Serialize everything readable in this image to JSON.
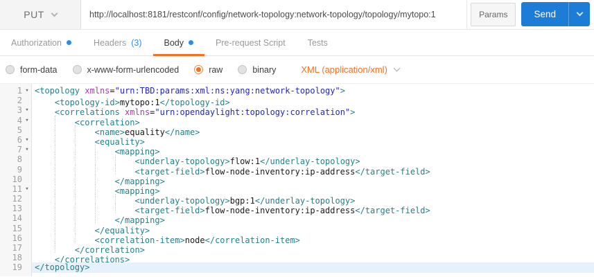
{
  "request_bar": {
    "method": "PUT",
    "url": "http://localhost:8181/restconf/config/network-topology:network-topology/topology/mytopo:1",
    "params_label": "Params",
    "send_label": "Send"
  },
  "tabs": [
    {
      "id": "authorization",
      "label": "Authorization",
      "dot": true,
      "count": "",
      "active": false
    },
    {
      "id": "headers",
      "label": "Headers",
      "dot": false,
      "count": "(3)",
      "active": false
    },
    {
      "id": "body",
      "label": "Body",
      "dot": true,
      "count": "",
      "active": true
    },
    {
      "id": "pre-request-script",
      "label": "Pre-request Script",
      "dot": false,
      "count": "",
      "active": false
    },
    {
      "id": "tests",
      "label": "Tests",
      "dot": false,
      "count": "",
      "active": false
    }
  ],
  "body_options": {
    "radios": [
      {
        "id": "form-data",
        "label": "form-data",
        "selected": false
      },
      {
        "id": "x-www-form-urlencoded",
        "label": "x-www-form-urlencoded",
        "selected": false
      },
      {
        "id": "raw",
        "label": "raw",
        "selected": true
      },
      {
        "id": "binary",
        "label": "binary",
        "selected": false
      }
    ],
    "content_type": "XML (application/xml)"
  },
  "colors": {
    "accent_orange": "#f47023",
    "dot_blue": "#2d8ceb",
    "send_blue": "#1c7cd6",
    "syntax_tag": "#23808a",
    "syntax_attr": "#a43db0",
    "syntax_string": "#2127c0",
    "syntax_text": "#1a1a1a",
    "line_number": "#9e9e9e",
    "active_line_bg": "#e6f1fb"
  },
  "editor": {
    "fold_marker": "▾",
    "lines": [
      {
        "num": 1,
        "fold": true,
        "active": false,
        "indent": 0,
        "segs": [
          {
            "t": "tag",
            "v": "<topology"
          },
          {
            "t": "text",
            "v": " "
          },
          {
            "t": "attr",
            "v": "xmlns"
          },
          {
            "t": "text",
            "v": "="
          },
          {
            "t": "str",
            "v": "\"urn:TBD:params:xml:ns:yang:network-topology\""
          },
          {
            "t": "tag",
            "v": ">"
          }
        ]
      },
      {
        "num": 2,
        "fold": false,
        "active": false,
        "indent": 1,
        "segs": [
          {
            "t": "tag",
            "v": "<topology-id>"
          },
          {
            "t": "text",
            "v": "mytopo:1"
          },
          {
            "t": "tag",
            "v": "</topology-id>"
          }
        ]
      },
      {
        "num": 3,
        "fold": true,
        "active": false,
        "indent": 1,
        "segs": [
          {
            "t": "tag",
            "v": "<correlations"
          },
          {
            "t": "text",
            "v": " "
          },
          {
            "t": "attr",
            "v": "xmlns"
          },
          {
            "t": "text",
            "v": "="
          },
          {
            "t": "str",
            "v": "\"urn:opendaylight:topology:correlation\""
          },
          {
            "t": "tag",
            "v": ">"
          }
        ]
      },
      {
        "num": 4,
        "fold": true,
        "active": false,
        "indent": 2,
        "segs": [
          {
            "t": "tag",
            "v": "<correlation>"
          }
        ]
      },
      {
        "num": 5,
        "fold": false,
        "active": false,
        "indent": 3,
        "segs": [
          {
            "t": "tag",
            "v": "<name>"
          },
          {
            "t": "text",
            "v": "equality"
          },
          {
            "t": "tag",
            "v": "</name>"
          }
        ]
      },
      {
        "num": 6,
        "fold": true,
        "active": false,
        "indent": 3,
        "segs": [
          {
            "t": "tag",
            "v": "<equality>"
          }
        ]
      },
      {
        "num": 7,
        "fold": true,
        "active": false,
        "indent": 4,
        "segs": [
          {
            "t": "tag",
            "v": "<mapping>"
          }
        ]
      },
      {
        "num": 8,
        "fold": false,
        "active": false,
        "indent": 5,
        "segs": [
          {
            "t": "tag",
            "v": "<underlay-topology>"
          },
          {
            "t": "text",
            "v": "flow:1"
          },
          {
            "t": "tag",
            "v": "</underlay-topology>"
          }
        ]
      },
      {
        "num": 9,
        "fold": false,
        "active": false,
        "indent": 5,
        "segs": [
          {
            "t": "tag",
            "v": "<target-field>"
          },
          {
            "t": "text",
            "v": "flow-node-inventory:ip-address"
          },
          {
            "t": "tag",
            "v": "</target-field>"
          }
        ]
      },
      {
        "num": 10,
        "fold": false,
        "active": false,
        "indent": 4,
        "segs": [
          {
            "t": "tag",
            "v": "</mapping>"
          }
        ]
      },
      {
        "num": 11,
        "fold": true,
        "active": false,
        "indent": 4,
        "segs": [
          {
            "t": "tag",
            "v": "<mapping>"
          }
        ]
      },
      {
        "num": 12,
        "fold": false,
        "active": false,
        "indent": 5,
        "segs": [
          {
            "t": "tag",
            "v": "<underlay-topology>"
          },
          {
            "t": "text",
            "v": "bgp:1"
          },
          {
            "t": "tag",
            "v": "</underlay-topology>"
          }
        ]
      },
      {
        "num": 13,
        "fold": false,
        "active": false,
        "indent": 5,
        "segs": [
          {
            "t": "tag",
            "v": "<target-field>"
          },
          {
            "t": "text",
            "v": "flow-node-inventory:ip-address"
          },
          {
            "t": "tag",
            "v": "</target-field>"
          }
        ]
      },
      {
        "num": 14,
        "fold": false,
        "active": false,
        "indent": 4,
        "segs": [
          {
            "t": "tag",
            "v": "</mapping>"
          }
        ]
      },
      {
        "num": 15,
        "fold": false,
        "active": false,
        "indent": 3,
        "segs": [
          {
            "t": "tag",
            "v": "</equality>"
          }
        ]
      },
      {
        "num": 16,
        "fold": false,
        "active": false,
        "indent": 3,
        "segs": [
          {
            "t": "tag",
            "v": "<correlation-item>"
          },
          {
            "t": "text",
            "v": "node"
          },
          {
            "t": "tag",
            "v": "</correlation-item>"
          }
        ]
      },
      {
        "num": 17,
        "fold": false,
        "active": false,
        "indent": 2,
        "segs": [
          {
            "t": "tag",
            "v": "</correlation>"
          }
        ]
      },
      {
        "num": 18,
        "fold": false,
        "active": false,
        "indent": 1,
        "segs": [
          {
            "t": "tag",
            "v": "</correlations>"
          }
        ]
      },
      {
        "num": 19,
        "fold": false,
        "active": true,
        "indent": 0,
        "segs": [
          {
            "t": "tag",
            "v": "</topology>"
          }
        ]
      }
    ]
  }
}
